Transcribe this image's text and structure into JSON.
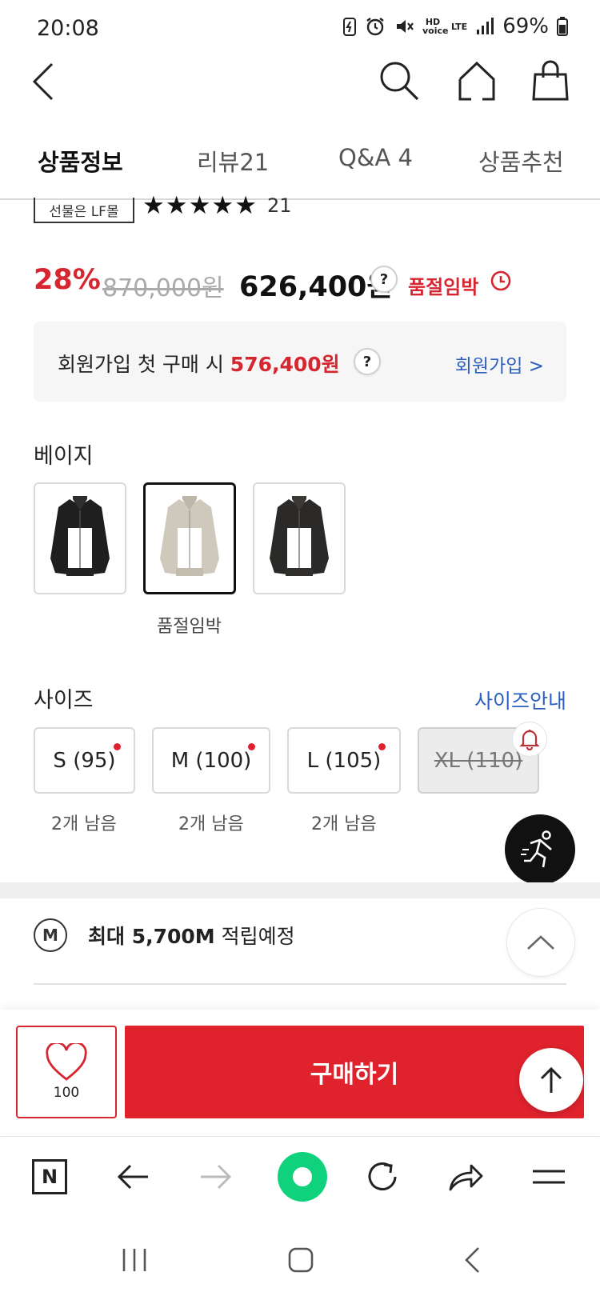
{
  "status_bar": {
    "time": "20:08",
    "battery": "69%",
    "hd_voice": "HD voice",
    "lte": "LTE"
  },
  "tabs": [
    {
      "label": "상품정보",
      "active": true
    },
    {
      "label": "리뷰21",
      "active": false
    },
    {
      "label": "Q&A 4",
      "active": false
    },
    {
      "label": "상품추천",
      "active": false
    }
  ],
  "product": {
    "gift_badge": "선물은 LF몰",
    "rating_stars": 5,
    "review_count": "21",
    "discount": "28%",
    "original_price": "870,000원",
    "sale_price": "626,400원",
    "help_mark": "?",
    "soldout_label": "품절임박"
  },
  "member_offer": {
    "text": "회원가입 첫 구매 시 ",
    "price": "576,400원",
    "link": "회원가입 >"
  },
  "color": {
    "title": "베이지",
    "swatches": [
      {
        "name": "black",
        "color": "#1f1f1f",
        "selected": false
      },
      {
        "name": "beige",
        "color": "#cfc9bd",
        "selected": true
      },
      {
        "name": "charcoal",
        "color": "#2b2a28",
        "selected": false
      }
    ],
    "selected_note": "품절임박"
  },
  "size": {
    "title": "사이즈",
    "guide_link": "사이즈안내",
    "options": [
      {
        "label": "S (95)",
        "stock": "2개 남음",
        "dot": true,
        "disabled": false
      },
      {
        "label": "M (100)",
        "stock": "2개 남음",
        "dot": true,
        "disabled": false
      },
      {
        "label": "L (105)",
        "stock": "2개 남음",
        "dot": true,
        "disabled": false
      },
      {
        "label": "XL (110)",
        "stock": "",
        "dot": false,
        "disabled": true
      }
    ]
  },
  "mileage": {
    "icon_letter": "M",
    "bold": "최대 5,700M",
    "text": " 적립예정"
  },
  "purchase": {
    "wish_count": "100",
    "buy_label": "구매하기"
  },
  "browser_toolbar": {
    "home_letter": "N"
  },
  "colors": {
    "accent_red": "#e0222d",
    "link_blue": "#2a5ec0",
    "green_dot": "#10d27c"
  }
}
